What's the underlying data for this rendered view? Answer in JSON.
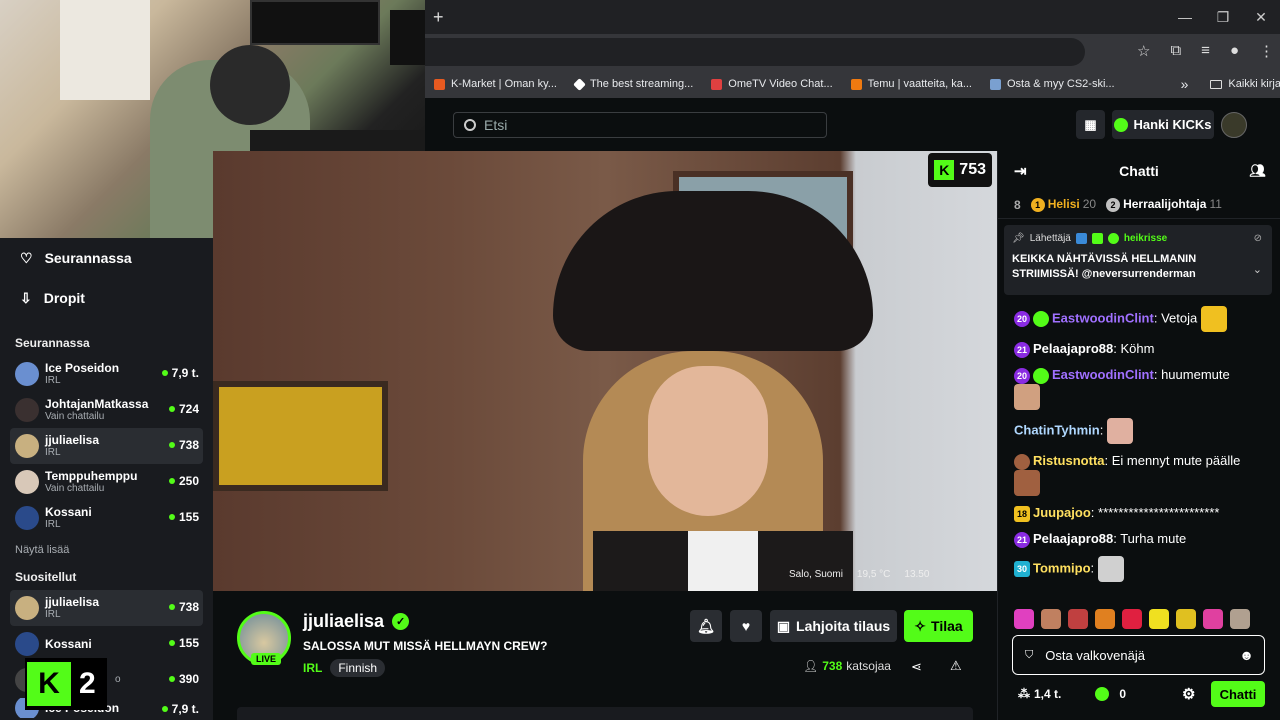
{
  "browser": {
    "newtab_icon": "+",
    "controls": [
      "—",
      "❐",
      "✕"
    ],
    "bookmarks": [
      {
        "label": "K-Market | Oman ky...",
        "color": "#e85a20"
      },
      {
        "label": "The best streaming...",
        "color": "#ffffff"
      },
      {
        "label": "OmeTV Video Chat...",
        "color": "#e04040"
      },
      {
        "label": "Temu | vaatteita, ka...",
        "color": "#f07a10"
      },
      {
        "label": "Osta & myy CS2-ski...",
        "color": "#7aa0d0"
      }
    ],
    "bookmarks_overflow": "»",
    "all_bookmarks": "Kaikki kirjanmerkit"
  },
  "header": {
    "search_placeholder": "Etsi",
    "kicks_label": "Hanki KICKs"
  },
  "sidebar": {
    "nav": [
      {
        "label": "Seurannassa",
        "icon": "heart-icon",
        "glyph": "♡"
      },
      {
        "label": "Dropit",
        "icon": "drops-icon",
        "glyph": "⇩"
      }
    ],
    "following_heading": "Seurannassa",
    "following": [
      {
        "name": "Ice Poseidon",
        "category": "IRL",
        "viewers": "7,9 t.",
        "color": "#6a8fd0"
      },
      {
        "name": "JohtajanMatkassa",
        "category": "Vain chattailu",
        "viewers": "724",
        "color": "#3a3030"
      },
      {
        "name": "jjuliaelisa",
        "category": "IRL",
        "viewers": "738",
        "color": "#c8b080"
      },
      {
        "name": "Temppuhemppu",
        "category": "Vain chattailu",
        "viewers": "250",
        "color": "#d8c8b8"
      },
      {
        "name": "Kossani",
        "category": "IRL",
        "viewers": "155",
        "color": "#2a4a8a"
      }
    ],
    "show_more": "Näytä lisää",
    "recommended_heading": "Suositellut",
    "recommended": [
      {
        "name": "jjuliaelisa",
        "category": "IRL",
        "viewers": "738",
        "color": "#c8b080"
      },
      {
        "name": "Kossani",
        "category": "",
        "viewers": "155",
        "color": "#2a4a8a"
      },
      {
        "name": "",
        "category": "o",
        "viewers": "390",
        "color": "#444444"
      },
      {
        "name": "Ice Poseidon",
        "category": "",
        "viewers": "7,9 t.",
        "color": "#6a8fd0"
      }
    ],
    "overlay_logo": "K",
    "overlay_number": "2"
  },
  "video": {
    "kick_count": "753",
    "location": "Salo, Suomi",
    "temp": "19,5 °C",
    "time": "13.50"
  },
  "stream": {
    "streamer": "jjuliaelisa",
    "live_label": "LIVE",
    "title": "SALOSSA MUT MISSÄ HELLMAYN CREW?",
    "category": "IRL",
    "tag": "Finnish",
    "gift_label": "Lahjoita tilaus",
    "subscribe_label": "Tilaa",
    "viewers_count": "738",
    "viewers_label": "katsojaa"
  },
  "chat": {
    "title": "Chatti",
    "leaderboard": [
      {
        "rank": "8",
        "name": "",
        "score": "",
        "color": ""
      },
      {
        "rank": "1",
        "name": "Helisi",
        "score": "20",
        "color": "#f0b020"
      },
      {
        "rank": "2",
        "name": "Herraalijohtaja",
        "score": "11",
        "color": "#c0c0c0"
      }
    ],
    "pinned": {
      "label": "Lähettäjä",
      "user": "heikrisse",
      "message": "KEIKKA NÄHTÄVISSÄ HELLMANIN STRIIMISSÄ! @neversurrenderman"
    },
    "messages": [
      {
        "badge": "20",
        "badge_color": "#8a2be2",
        "green": true,
        "user": "EastwoodinClint",
        "user_color": "#a070ff",
        "text": ": Vetoja",
        "emote": "#f0c020"
      },
      {
        "badge": "21",
        "badge_color": "#8a2be2",
        "green": false,
        "user": "Pelaajapro88",
        "user_color": "#ffffff",
        "text": ": Köhm",
        "emote": ""
      },
      {
        "badge": "20",
        "badge_color": "#8a2be2",
        "green": true,
        "user": "EastwoodinClint",
        "user_color": "#a070ff",
        "text": ": huumemute",
        "emote": "#d0a080"
      },
      {
        "badge": "",
        "badge_color": "",
        "green": false,
        "user": "ChatinTyhmin",
        "user_color": "#b0d8ff",
        "text": ":",
        "emote": "#e0b0a0"
      },
      {
        "badge": "",
        "badge_color": "",
        "green": false,
        "user": "Ristusnotta",
        "user_color": "#ffe060",
        "text": ": Ei mennyt mute päälle",
        "emote": "#a06040"
      },
      {
        "badge": "18",
        "badge_color": "#f0c020",
        "green": false,
        "user": "Juupajoo",
        "user_color": "#ffe060",
        "text": ": ************************",
        "emote": ""
      },
      {
        "badge": "21",
        "badge_color": "#8a2be2",
        "green": false,
        "user": "Pelaajapro88",
        "user_color": "#ffffff",
        "text": ": Turha mute",
        "emote": ""
      },
      {
        "badge": "30",
        "badge_color": "#20b0d0",
        "green": false,
        "user": "Tommipo",
        "user_color": "#ffe060",
        "text": ":",
        "emote": "#d0d0d0"
      }
    ],
    "emote_bar": [
      "#e040c0",
      "#c08060",
      "#c04040",
      "#e08020",
      "#e02040",
      "#f0e020",
      "#e0c020",
      "#e040a0",
      "#b0a090"
    ],
    "input_value": "Osta valkovenäjä",
    "points": "1,4 t.",
    "kicks": "0",
    "send_label": "Chatti"
  }
}
